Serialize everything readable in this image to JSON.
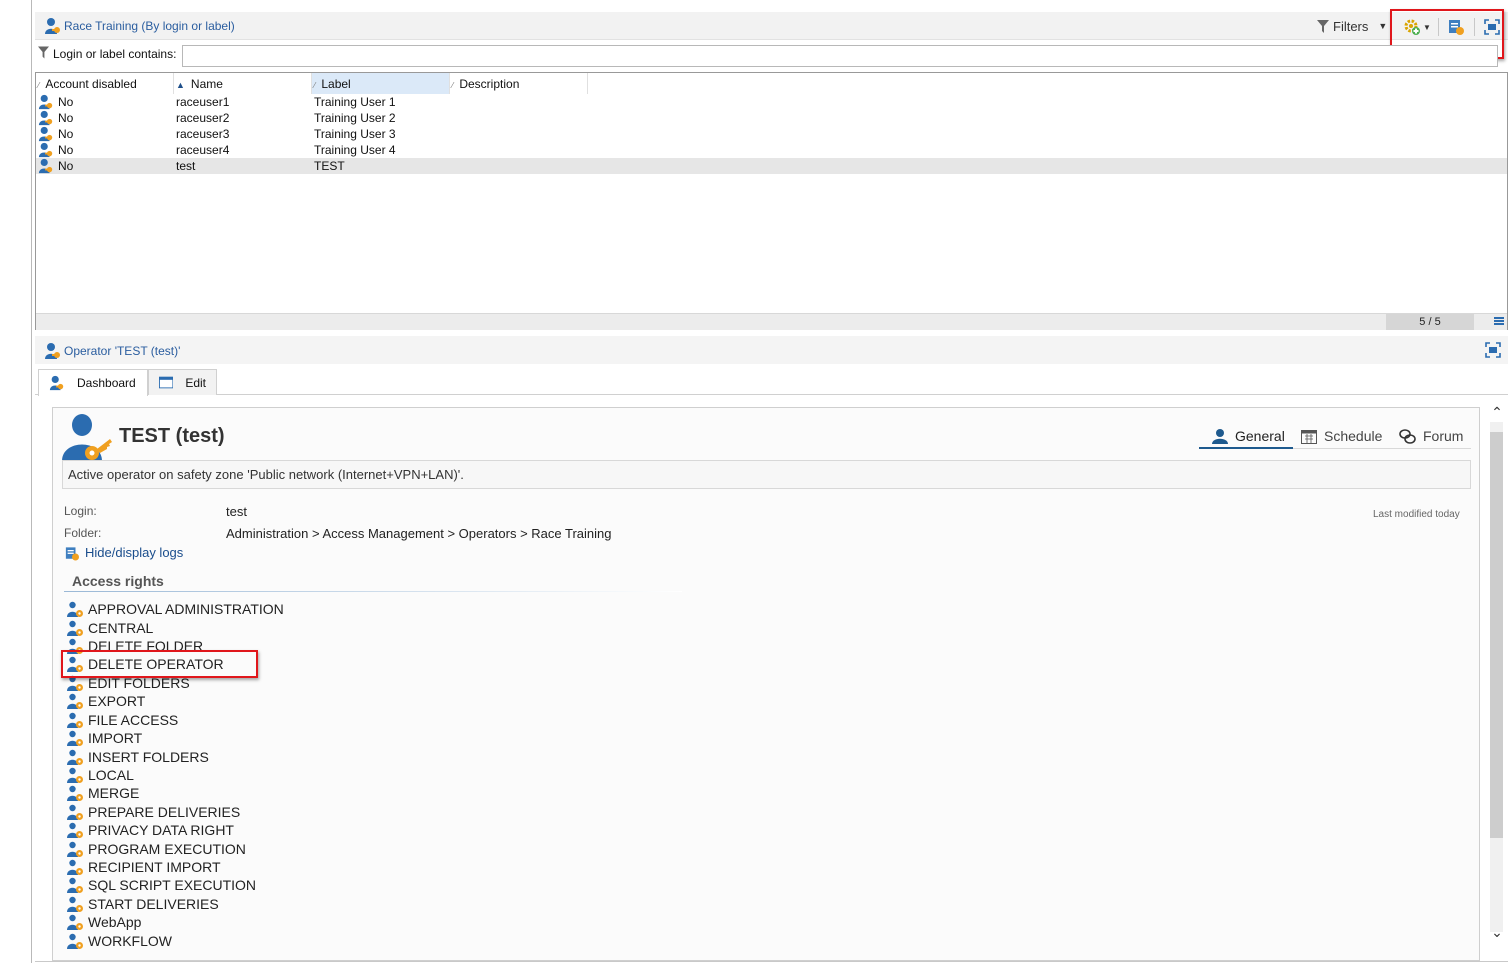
{
  "list_panel": {
    "title": "Race Training (By login or label)",
    "filters_label": "Filters",
    "filter_label": "Login or label contains:",
    "filter_value": "",
    "columns": [
      "Account disabled",
      "Name",
      "Label",
      "Description"
    ],
    "rows": [
      {
        "disabled": "No",
        "name": "raceuser1",
        "label": "Training User 1",
        "description": ""
      },
      {
        "disabled": "No",
        "name": "raceuser2",
        "label": "Training User 2",
        "description": ""
      },
      {
        "disabled": "No",
        "name": "raceuser3",
        "label": "Training User 3",
        "description": ""
      },
      {
        "disabled": "No",
        "name": "raceuser4",
        "label": "Training User 4",
        "description": ""
      },
      {
        "disabled": "No",
        "name": "test",
        "label": "TEST",
        "description": ""
      }
    ],
    "count": "5 / 5"
  },
  "operator_panel": {
    "title": "Operator 'TEST (test)'",
    "tabs": [
      "Dashboard",
      "Edit"
    ],
    "name": "TEST (test)",
    "right_tabs": [
      "General",
      "Schedule",
      "Forum"
    ],
    "zone_message": "Active operator on safety zone 'Public network (Internet+VPN+LAN)'.",
    "login_label": "Login:",
    "login_value": "test",
    "folder_label": "Folder:",
    "folder_value": "Administration > Access Management > Operators > Race Training",
    "last_modified": "Last modified today",
    "logs_link": "Hide/display logs",
    "access_rights_title": "Access rights",
    "access_rights": [
      "APPROVAL ADMINISTRATION",
      "CENTRAL",
      "DELETE FOLDER",
      "DELETE OPERATOR",
      "EDIT FOLDERS",
      "EXPORT",
      "FILE ACCESS",
      "IMPORT",
      "INSERT FOLDERS",
      "LOCAL",
      "MERGE",
      "PREPARE DELIVERIES",
      "PRIVACY DATA RIGHT",
      "PROGRAM EXECUTION",
      "RECIPIENT IMPORT",
      "SQL SCRIPT EXECUTION",
      "START DELIVERIES",
      "WebApp",
      "WORKFLOW"
    ]
  },
  "icons": {
    "operator": "operator-key-icon",
    "filter": "funnel-icon",
    "actions": "gear-actions-icon",
    "logs": "logs-icon",
    "maximize": "maximize-icon",
    "general": "person-icon",
    "schedule": "calendar-icon",
    "forum": "chat-icon"
  },
  "colors": {
    "accent": "#1e5a8e",
    "link": "#1a4d8c",
    "highlight": "#e0161b",
    "key_orange": "#f0a020"
  }
}
